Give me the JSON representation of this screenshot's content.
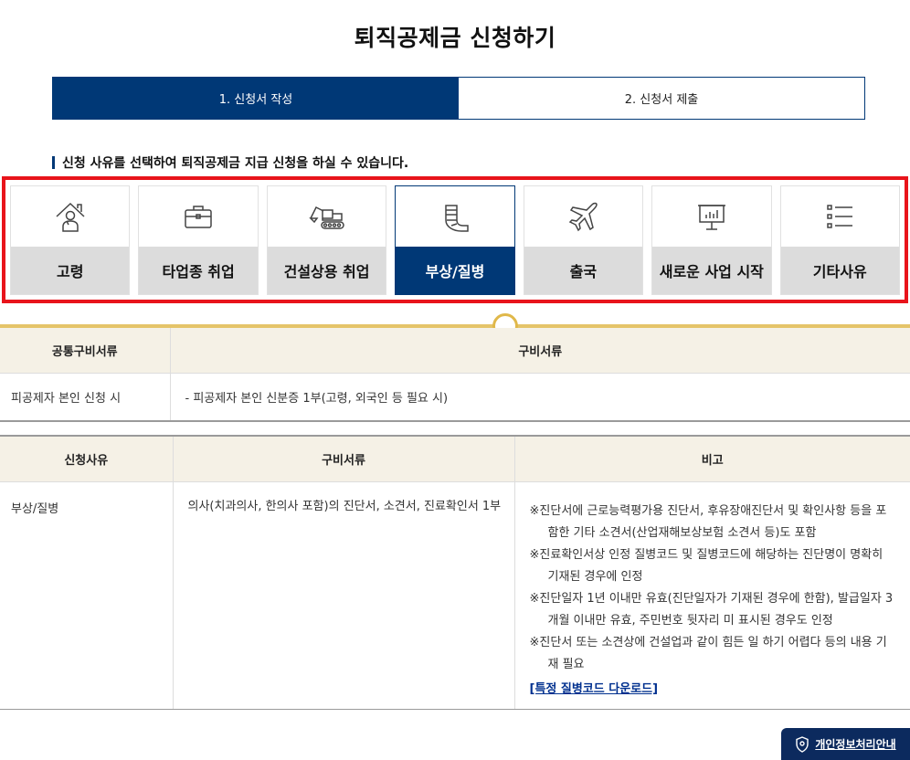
{
  "page": {
    "title": "퇴직공제금 신청하기"
  },
  "steps": [
    {
      "label": "1. 신청서 작성",
      "active": true
    },
    {
      "label": "2. 신청서 제출",
      "active": false
    }
  ],
  "intro_text": "신청 사유를 선택하여 퇴직공제금 지급 신청을 하실 수 있습니다.",
  "reasons": [
    {
      "label": "고령",
      "icon": "elderly-house-icon",
      "selected": false
    },
    {
      "label": "타업종 취업",
      "icon": "briefcase-icon",
      "selected": false
    },
    {
      "label": "건설상용 취업",
      "icon": "excavator-icon",
      "selected": false
    },
    {
      "label": "부상/질병",
      "icon": "injured-arm-icon",
      "selected": true
    },
    {
      "label": "출국",
      "icon": "airplane-icon",
      "selected": false
    },
    {
      "label": "새로운 사업 시작",
      "icon": "presentation-board-icon",
      "selected": false
    },
    {
      "label": "기타사유",
      "icon": "list-icon",
      "selected": false
    }
  ],
  "common_docs_table": {
    "headers": [
      "공통구비서류",
      "구비서류"
    ],
    "row": [
      "피공제자 본인 신청 시",
      "- 피공제자 본인 신분증 1부(고령, 외국인 등 필요 시)"
    ]
  },
  "reason_docs_table": {
    "headers": [
      "신청사유",
      "구비서류",
      "비고"
    ],
    "row": {
      "reason": "부상/질병",
      "docs": "의사(치과의사, 한의사 포함)의 진단서, 소견서, 진료확인서 1부",
      "remarks": [
        "※진단서에 근로능력평가용 진단서, 후유장애진단서 및 확인사항 등을 포함한 기타 소견서(산업재해보상보험 소견서 등)도 포함",
        "※진료확인서상 인정 질병코드 및 질병코드에 해당하는 진단명이 명확히 기재된 경우에 인정",
        "※진단일자 1년 이내만 유효(진단일자가 기재된 경우에 한함), 발급일자 3개월 이내만 유효, 주민번호 뒷자리 미 표시된 경우도 인정",
        "※진단서 또는 소견상에 건설업과 같이 힘든 일 하기 어렵다 등의 내용 기재 필요"
      ],
      "link": "[특정 질병코드 다운로드]"
    }
  },
  "privacy_button": {
    "label": "개인정보처리안내"
  },
  "colors": {
    "primary": "#003876",
    "highlight": "#e8141b",
    "gold": "#e0b84a",
    "table_header": "#f5f1e6"
  }
}
